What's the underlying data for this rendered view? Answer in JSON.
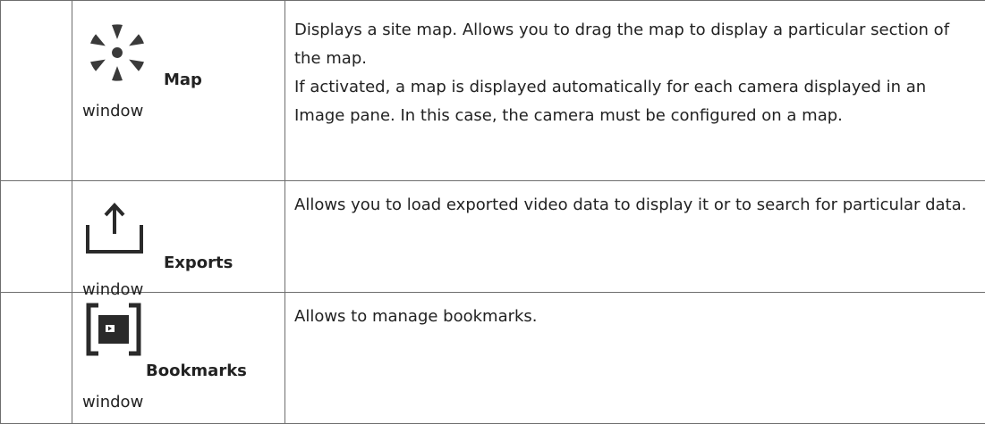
{
  "rows": [
    {
      "name": "Map",
      "suffix": "window",
      "icon": "compass-star-icon",
      "description": [
        "Displays a site map. Allows you to drag the map to display a particular section of the map.",
        "If activated, a map is displayed automatically for each camera displayed in an Image pane. In this case, the camera must be configured on a map."
      ]
    },
    {
      "name": "Exports",
      "suffix": "window",
      "icon": "export-upload-icon",
      "description": [
        "Allows you to load exported video data to display it or to search for particular data."
      ]
    },
    {
      "name": "Bookmarks",
      "suffix": "window",
      "icon": "bookmark-frame-icon",
      "description": [
        "Allows to manage bookmarks."
      ]
    }
  ]
}
